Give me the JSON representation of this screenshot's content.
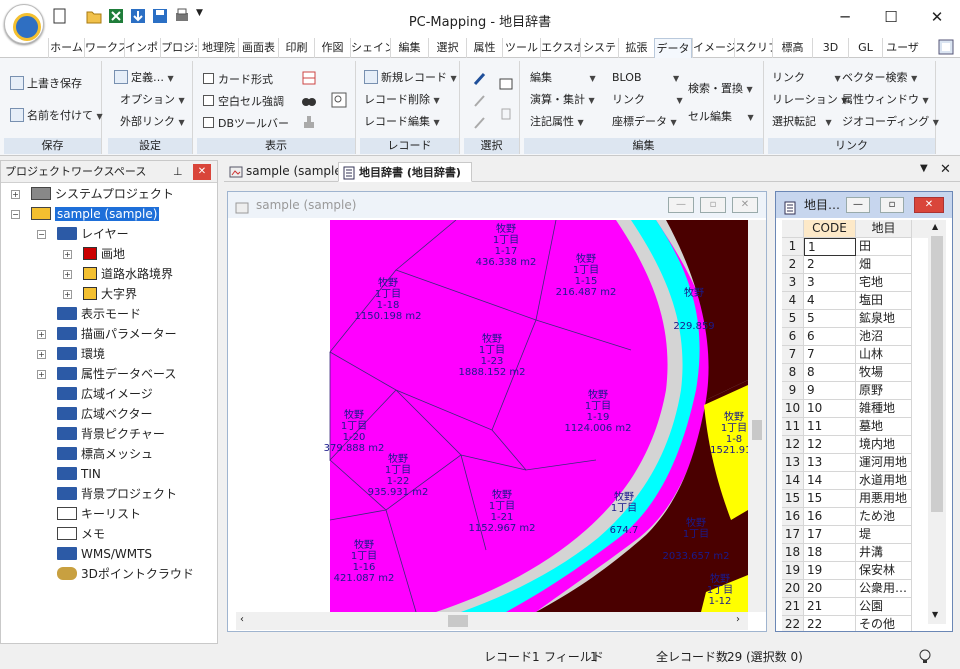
{
  "app": {
    "title": "PC-Mapping - 地目辞書"
  },
  "window": {
    "minimize": "─",
    "maximize": "☐",
    "close": "✕"
  },
  "ribbon_tabs": [
    "ホーム",
    "ワークス",
    "インポ・",
    "プロジ:",
    "地理院",
    "画面表",
    "印刷",
    "作図",
    "シェイン",
    "編集",
    "選択",
    "属性",
    "ツール",
    "エクスポ",
    "システ",
    "拡張",
    "データ",
    "イメージ",
    "スクリプ",
    "標高",
    "3D",
    "GL",
    "ユーザ"
  ],
  "active_tab_index": 16,
  "ribbon": {
    "hozon": {
      "label": "保存",
      "btn1": "上書き保存",
      "btn2": "名前を付けて"
    },
    "settei": {
      "label": "設定",
      "btn1": "定義…",
      "btn2": "オプション",
      "btn3": "外部リンク"
    },
    "hyouji": {
      "label": "表示",
      "chk1": "カード形式",
      "chk2": "空白セル強調",
      "chk3": "DBツールバー"
    },
    "record": {
      "label": "レコード",
      "btn1": "新規レコード",
      "btn2": "レコード削除",
      "btn3": "レコード編集"
    },
    "sentaku": {
      "label": "選択"
    },
    "hensyu": {
      "label": "編集",
      "btn1": "編集",
      "btn2": "演算・集計",
      "btn3": "注記属性",
      "btn4": "BLOB",
      "btn5": "リンク",
      "btn6": "座標データ",
      "btn7": "検索・置換",
      "btn8": "セル編集"
    },
    "link": {
      "label": "リンク",
      "btn1": "リンク",
      "btn2": "リレーション",
      "btn3": "選択転記",
      "btn4": "ベクター検索",
      "btn5": "属性ウィンドウ",
      "btn6": "ジオコーディング"
    }
  },
  "workspace": {
    "title": "プロジェクトワークスペース",
    "nodes": [
      "システムプロジェクト",
      "sample (sample)",
      "レイヤー",
      "画地",
      "道路水路境界",
      "大字界",
      "表示モード",
      "描画パラメーター",
      "環境",
      "属性データベース",
      "広域イメージ",
      "広域ベクター",
      "背景ピクチャー",
      "標高メッシュ",
      "TIN",
      "背景プロジェクト",
      "キーリスト",
      "メモ",
      "WMS/WMTS",
      "3Dポイントクラウド"
    ]
  },
  "doc_tabs": [
    "sample (sample)",
    "地目辞書 (地目辞書)"
  ],
  "map_window": {
    "title": "sample (sample)"
  },
  "map_labels": [
    {
      "name": "牧野",
      "chome": "1丁目",
      "num": "1-17",
      "area": "436.338 m2"
    },
    {
      "name": "牧野",
      "chome": "1丁目",
      "num": "1-15",
      "area": "216.487 m2"
    },
    {
      "name": "牧野",
      "chome": "1丁目",
      "num": "1-18",
      "area": "1150.198 m2"
    },
    {
      "name": "牧野",
      "chome": "1丁目",
      "num": "1-23",
      "area": "1888.152 m2"
    },
    {
      "name": "牧野",
      "chome": "1丁目",
      "num": "1-19",
      "area": "1124.006 m2"
    },
    {
      "name": "牧野",
      "chome": "1丁目",
      "num": "1-20",
      "area": "379.888 m2"
    },
    {
      "name": "牧野",
      "chome": "1丁目",
      "num": "1-22",
      "area": "935.931 m2"
    },
    {
      "name": "牧野",
      "chome": "1丁目",
      "num": "1-21",
      "area": "1152.967 m2"
    },
    {
      "name": "牧野",
      "chome": "1丁目",
      "num": "1-16",
      "area": "421.087 m2"
    },
    {
      "name": "牧野",
      "chome": "1丁目",
      "num": "",
      "area": "674.7"
    },
    {
      "name": "牧野",
      "chome": "1丁目",
      "num": "1-8",
      "area": "1521.919"
    },
    {
      "name": "牧野",
      "chome": "",
      "num": "",
      "area": "229.859"
    },
    {
      "name": "牧野",
      "chome": "1丁目",
      "num": "",
      "area": "2033.657 m2"
    },
    {
      "name": "牧野",
      "chome": "1丁目",
      "num": "1-12",
      "area": ""
    }
  ],
  "grid_window": {
    "title": "地目…",
    "col1": "CODE",
    "col2": "地目"
  },
  "grid_rows": [
    [
      "1",
      "1",
      "田"
    ],
    [
      "2",
      "2",
      "畑"
    ],
    [
      "3",
      "3",
      "宅地"
    ],
    [
      "4",
      "4",
      "塩田"
    ],
    [
      "5",
      "5",
      "鉱泉地"
    ],
    [
      "6",
      "6",
      "池沼"
    ],
    [
      "7",
      "7",
      "山林"
    ],
    [
      "8",
      "8",
      "牧場"
    ],
    [
      "9",
      "9",
      "原野"
    ],
    [
      "10",
      "10",
      "雑種地"
    ],
    [
      "11",
      "11",
      "墓地"
    ],
    [
      "12",
      "12",
      "境内地"
    ],
    [
      "13",
      "13",
      "運河用地"
    ],
    [
      "14",
      "14",
      "水道用地"
    ],
    [
      "15",
      "15",
      "用悪用地"
    ],
    [
      "16",
      "16",
      "ため池"
    ],
    [
      "17",
      "17",
      "堤"
    ],
    [
      "18",
      "18",
      "井溝"
    ],
    [
      "19",
      "19",
      "保安林"
    ],
    [
      "20",
      "20",
      "公衆用…"
    ],
    [
      "21",
      "21",
      "公園"
    ],
    [
      "22",
      "22",
      "その他"
    ]
  ],
  "status": {
    "record_label": "レコード",
    "record_val": "1",
    "field_label": "フィールド",
    "field_val": "1",
    "total_label": "全レコード数",
    "total_val": "29",
    "sel_text": "(選択数  0)"
  },
  "colors": {
    "magenta": "#ff00ff",
    "cyan": "#00ffff",
    "brown": "#4a0000",
    "yellow": "#ffff00",
    "gray": "#d4d4d4"
  }
}
